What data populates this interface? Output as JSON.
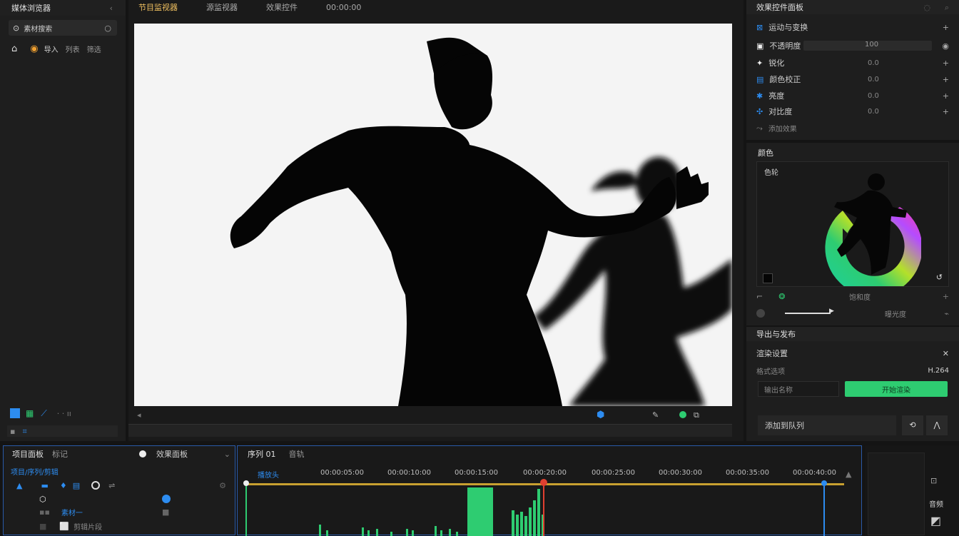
{
  "app": {
    "left_panel_title": "媒体浏览器",
    "left_search_label": "素材搜索",
    "left_tools": [
      "导入",
      "列表",
      "筛选"
    ],
    "left_footer_icons": [
      "grid-icon",
      "list-icon",
      "slider-icon"
    ]
  },
  "viewer": {
    "tabs": [
      "节目监视器",
      "源监视器",
      "效果控件",
      "00:00:00"
    ],
    "active_tab": 0
  },
  "effects_panel": {
    "title": "效果控件面板",
    "rows": [
      {
        "label": "运动与变换",
        "value": ""
      },
      {
        "label": "不透明度",
        "value": "100"
      },
      {
        "label": "锐化",
        "value": "0.0"
      },
      {
        "label": "颜色校正",
        "value": "0.0"
      },
      {
        "label": "亮度",
        "value": "0.0"
      },
      {
        "label": "对比度",
        "value": "0.0"
      }
    ],
    "footer": "添加效果"
  },
  "color_panel": {
    "title": "颜色",
    "subtitle": "色轮",
    "bottom_label": "饱和度",
    "slider_label": "曝光度"
  },
  "export_panel": {
    "title": "导出与发布",
    "section": "渲染设置",
    "format_label": "格式选项",
    "format_value": "H.264",
    "field_placeholder": "输出名称",
    "primary_button": "开始渲染",
    "footer_label": "添加到队列"
  },
  "project_panel": {
    "title": "项目面板",
    "tab2": "标记",
    "effects_tab": "效果面板",
    "path": "项目/序列/剪辑",
    "item_label": "素材一",
    "item_label2": "剪辑片段"
  },
  "timeline": {
    "title": "序列 01",
    "tab2": "音轨",
    "playhead_label": "播放头",
    "ticks": [
      "00:00:05:00",
      "00:00:10:00",
      "00:00:15:00",
      "00:00:20:00",
      "00:00:25:00",
      "00:00:30:00",
      "00:00:35:00",
      "00:00:40:00"
    ]
  },
  "right_strip": {
    "label": "音频"
  },
  "accent": "#2ecc71",
  "highlight": "#1e90ff"
}
